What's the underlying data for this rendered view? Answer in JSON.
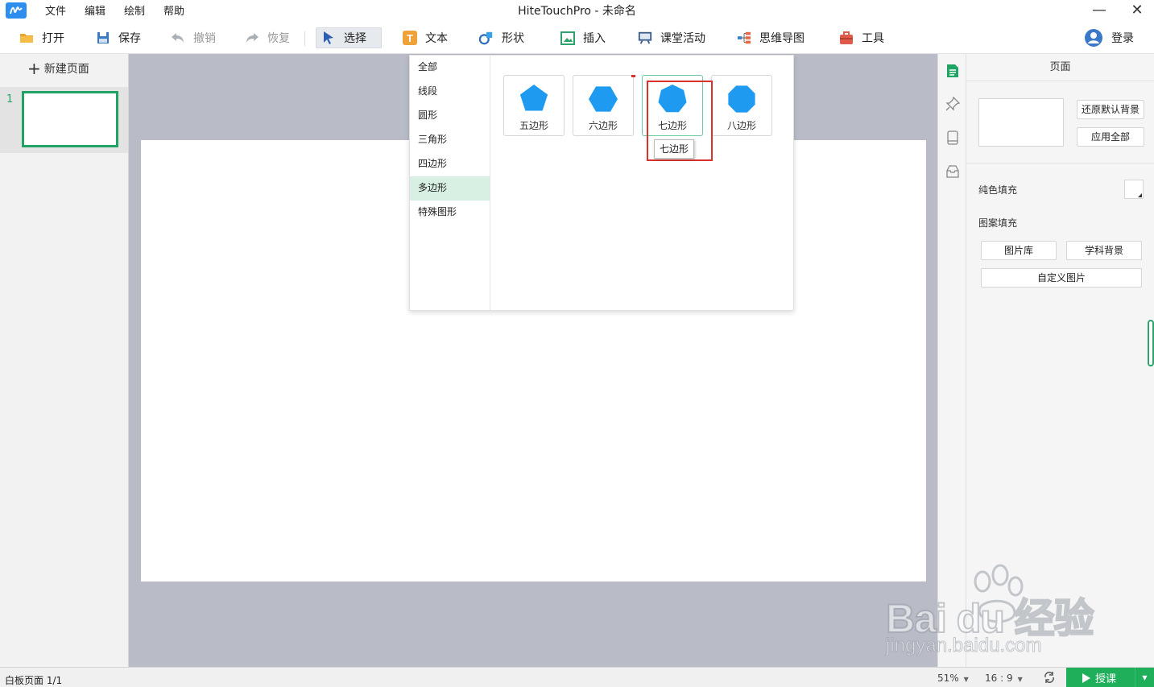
{
  "window": {
    "title": "HiteTouchPro - 未命名",
    "logo_text": "",
    "minimize": "—",
    "close": "✕"
  },
  "menu": [
    "文件",
    "编辑",
    "绘制",
    "帮助"
  ],
  "toolbar": {
    "open": "打开",
    "save": "保存",
    "undo": "撤销",
    "redo": "恢复",
    "select": "选择",
    "text": "文本",
    "shape": "形状",
    "insert": "插入",
    "class_activity": "课堂活动",
    "mind_map": "思维导图",
    "tools": "工具",
    "login": "登录"
  },
  "pages_panel": {
    "new_page": "新建页面",
    "pages": [
      {
        "number": "1"
      }
    ]
  },
  "shape_panel": {
    "categories": [
      "全部",
      "线段",
      "圆形",
      "三角形",
      "四边形",
      "多边形",
      "特殊图形"
    ],
    "selected_category": "多边形",
    "shapes": [
      {
        "label": "五边形",
        "sides": 5,
        "icon": "pentagon-icon"
      },
      {
        "label": "六边形",
        "sides": 6,
        "icon": "hexagon-icon"
      },
      {
        "label": "七边形",
        "sides": 7,
        "icon": "heptagon-icon"
      },
      {
        "label": "八边形",
        "sides": 8,
        "icon": "octagon-icon"
      }
    ],
    "shape_color": "#1e9bf0",
    "tooltip": "七边形"
  },
  "props_panel": {
    "title": "页面",
    "restore_default_bg": "还原默认背景",
    "apply_all": "应用全部",
    "solid_fill": "纯色填充",
    "pattern_fill": "图案填充",
    "image_library": "图片库",
    "subject_bg": "学科背景",
    "custom_image": "自定义图片"
  },
  "statusbar": {
    "page_info": "白板页面 1/1",
    "zoom": "51%",
    "ratio": "16 : 9",
    "teach": "授课"
  },
  "watermark": {
    "brand": "Bai du 经验",
    "url": "jingyan.baidu.com"
  },
  "colors": {
    "accent_green": "#1fa463",
    "shape_blue": "#1e9bf0",
    "highlight_red": "#d9312b",
    "canvas_bg": "#b9bcc6"
  }
}
